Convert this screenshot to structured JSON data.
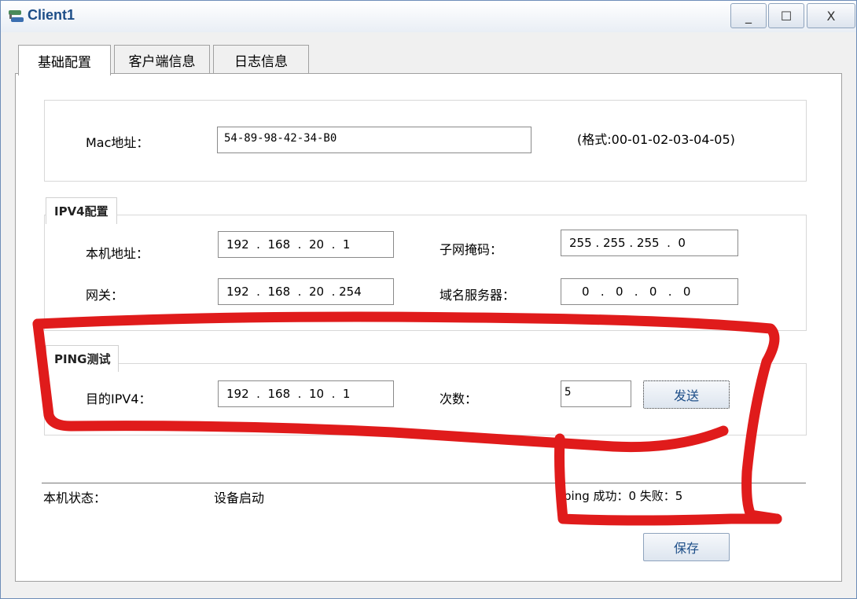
{
  "window": {
    "title": "Client1",
    "minimize": "_",
    "maximize": "☐",
    "close": "X"
  },
  "tabs": [
    "基础配置",
    "客户端信息",
    "日志信息"
  ],
  "mac": {
    "label": "Mac地址：",
    "value": "54-89-98-42-34-B0",
    "hint": "(格式:00-01-02-03-04-05)"
  },
  "ipv4": {
    "legend": "IPV4配置",
    "local_label": "本机地址：",
    "local_ip": [
      "192",
      "168",
      "20",
      "1"
    ],
    "mask_label": "子网掩码：",
    "mask": [
      "255",
      "255",
      "255",
      "0"
    ],
    "gateway_label": "网关：",
    "gateway": [
      "192",
      "168",
      "20",
      "254"
    ],
    "dns_label": "域名服务器：",
    "dns": [
      "0",
      "0",
      "0",
      "0"
    ]
  },
  "ping": {
    "legend": "PING测试",
    "dest_label": "目的IPV4：",
    "dest": [
      "192",
      "168",
      "10",
      "1"
    ],
    "count_label": "次数：",
    "count": "5",
    "send": "发送"
  },
  "status": {
    "label": "本机状态：",
    "value": "设备启动",
    "result": "ping 成功：0   失败：5"
  },
  "save": "保存",
  "colors": {
    "annotation": "#e01b1b",
    "title": "#1d4e88"
  }
}
